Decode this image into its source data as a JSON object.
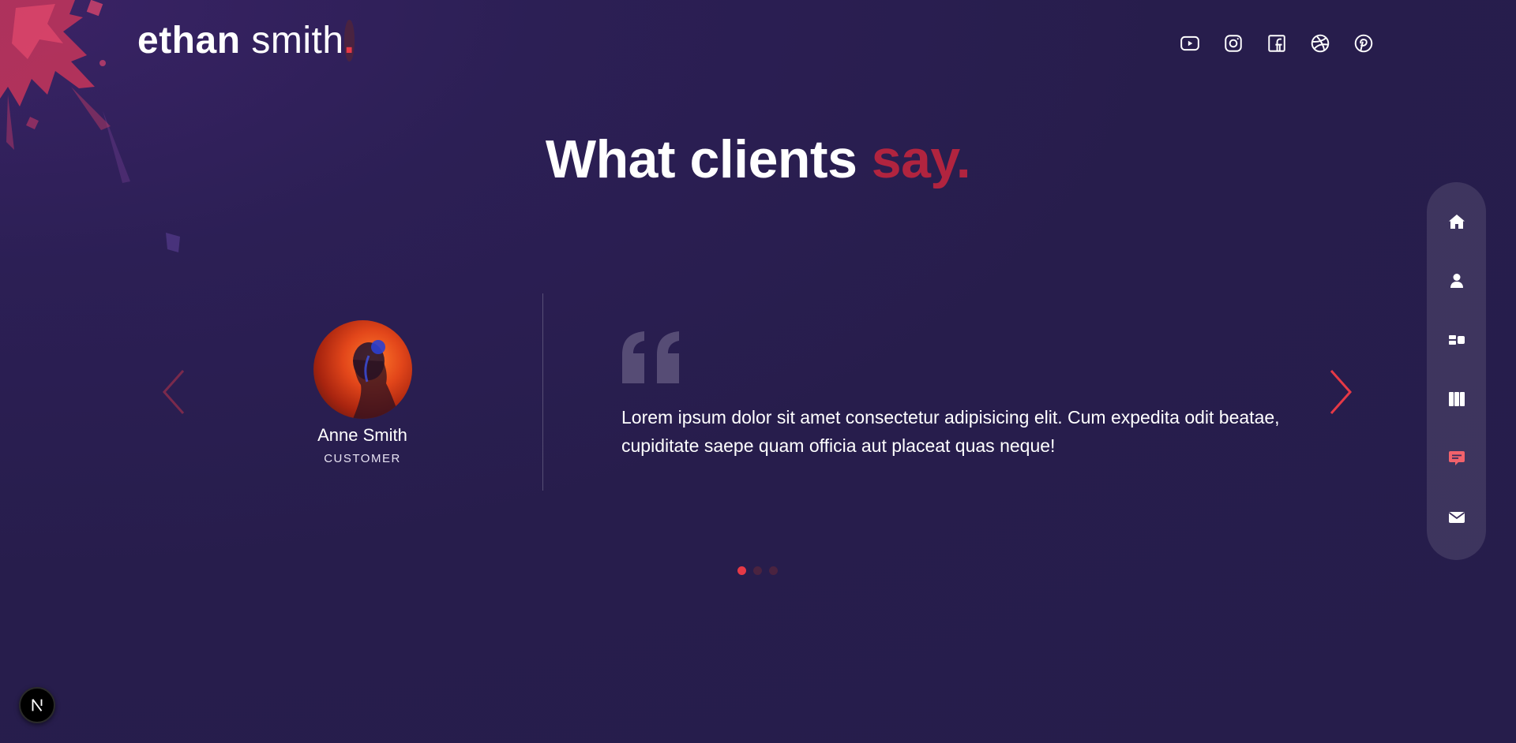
{
  "header": {
    "logo_first": "ethan",
    "logo_last": "smith",
    "logo_dot": ".",
    "social": [
      {
        "name": "youtube-icon"
      },
      {
        "name": "instagram-icon"
      },
      {
        "name": "facebook-icon"
      },
      {
        "name": "dribbble-icon"
      },
      {
        "name": "pinterest-icon"
      }
    ]
  },
  "heading": {
    "main": "What clients ",
    "accent": "say."
  },
  "testimonial": {
    "name": "Anne Smith",
    "role": "CUSTOMER",
    "quote": "Lorem ipsum dolor sit amet consectetur adipisicing elit. Cum expedita odit beatae, cupiditate saepe quam officia aut placeat quas neque!"
  },
  "slider": {
    "total": 3,
    "active_index": 0
  },
  "sidenav": {
    "items": [
      {
        "icon": "home-icon"
      },
      {
        "icon": "user-icon"
      },
      {
        "icon": "services-icon"
      },
      {
        "icon": "work-icon"
      },
      {
        "icon": "testimonials-icon",
        "active": true
      },
      {
        "icon": "mail-icon"
      }
    ],
    "active_color": "#f1626b"
  },
  "colors": {
    "background": "#281e4d",
    "accent": "#e63946",
    "heading_accent": "#b1243f"
  }
}
